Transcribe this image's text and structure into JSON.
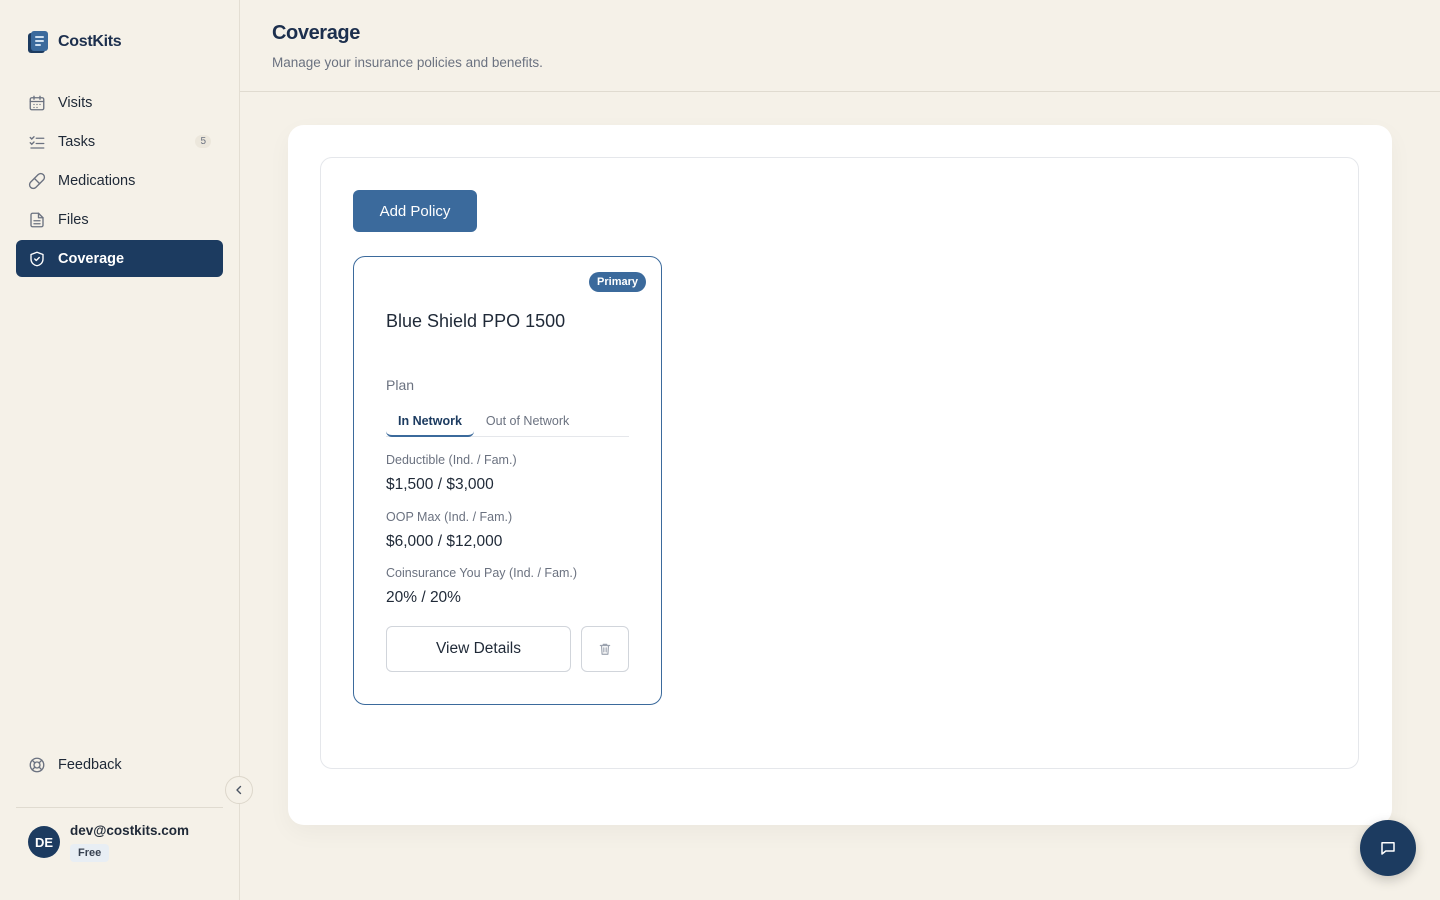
{
  "brand": {
    "name": "CostKits",
    "logo_icon": "notebook-logo"
  },
  "sidebar": {
    "items": [
      {
        "label": "Visits",
        "icon": "calendar-icon"
      },
      {
        "label": "Tasks",
        "icon": "checklist-icon",
        "badge": "5"
      },
      {
        "label": "Medications",
        "icon": "pill-icon"
      },
      {
        "label": "Files",
        "icon": "file-icon"
      },
      {
        "label": "Coverage",
        "icon": "shield-check-icon",
        "active": true
      }
    ],
    "feedback_label": "Feedback",
    "collapse_icon": "chevron-left-icon"
  },
  "user": {
    "initials": "DE",
    "email": "dev@costkits.com",
    "plan": "Free"
  },
  "header": {
    "title": "Coverage",
    "subtitle": "Manage your insurance policies and benefits."
  },
  "main": {
    "add_policy_label": "Add Policy",
    "policy": {
      "badge": "Primary",
      "name": "Blue Shield PPO 1500",
      "type": "Plan",
      "tabs": [
        "In Network",
        "Out of Network"
      ],
      "active_tab": "In Network",
      "metrics": [
        {
          "label": "Deductible (Ind. / Fam.)",
          "value": "$1,500 / $3,000"
        },
        {
          "label": "OOP Max (Ind. / Fam.)",
          "value": "$6,000 / $12,000"
        },
        {
          "label": "Coinsurance You Pay (Ind. / Fam.)",
          "value": "20% / 20%"
        }
      ],
      "view_details_label": "View Details",
      "delete_icon": "trash-icon"
    }
  },
  "chat_icon": "chat-bubble-icon",
  "colors": {
    "background": "#f5f1e8",
    "sidebar_active": "#1c3b60",
    "accent": "#3b6a9c",
    "text": "#1f2937",
    "muted": "#6b7280"
  }
}
